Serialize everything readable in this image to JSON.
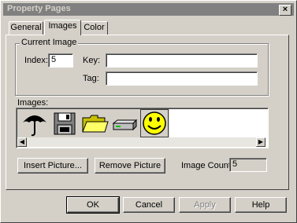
{
  "window": {
    "title": "Property Pages",
    "close_label": "×"
  },
  "tabs": [
    {
      "label": "General",
      "active": false
    },
    {
      "label": "Images",
      "active": true
    },
    {
      "label": "Color",
      "active": false
    }
  ],
  "current_image": {
    "group_label": "Current Image",
    "index_label": "Index:",
    "index_value": "5",
    "key_label": "Key:",
    "key_value": "",
    "tag_label": "Tag:",
    "tag_value": ""
  },
  "images": {
    "label": "Images:",
    "items": [
      "umbrella-icon",
      "floppy-disk-icon",
      "folder-icon",
      "drive-icon",
      "smiley-face-icon"
    ],
    "selected_index": 4
  },
  "buttons": {
    "insert_picture": "Insert Picture...",
    "remove_picture": "Remove Picture",
    "ok": "OK",
    "cancel": "Cancel",
    "apply": "Apply",
    "help": "Help"
  },
  "image_count": {
    "label": "Image Count:",
    "value": "5"
  },
  "colors": {
    "face": "#d4d0c8",
    "title_inactive": "#808080",
    "smiley": "#ffff00"
  }
}
